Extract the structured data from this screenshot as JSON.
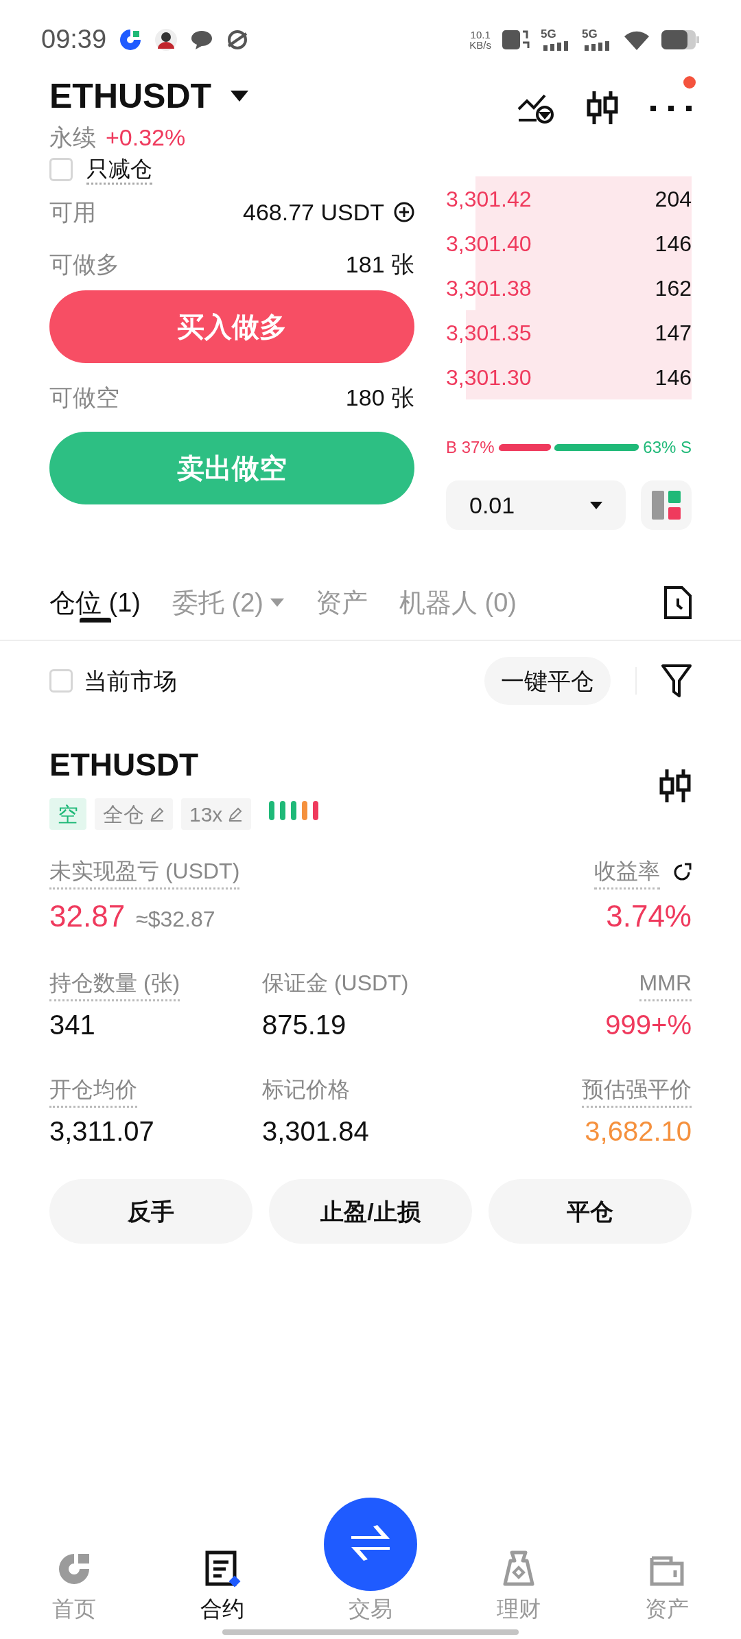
{
  "status_bar": {
    "time": "09:39",
    "speed": "10.1",
    "speed_unit": "KB/s",
    "sim_1": "5G",
    "sim_2": "5G"
  },
  "header": {
    "symbol": "ETHUSDT",
    "type": "永续",
    "change": "+0.32%",
    "notification": true
  },
  "order_form": {
    "reduce_only": {
      "label": "只减仓",
      "checked": false
    },
    "available": {
      "label": "可用",
      "value": "468.77 USDT"
    },
    "long": {
      "label": "可做多",
      "value": "181 张",
      "button": "买入做多"
    },
    "short": {
      "label": "可做空",
      "value": "180 张",
      "button": "卖出做空"
    }
  },
  "order_book": {
    "asks": [
      {
        "price": "3,301.42",
        "size": "204"
      },
      {
        "price": "3,301.40",
        "size": "146"
      },
      {
        "price": "3,301.38",
        "size": "162"
      },
      {
        "price": "3,301.35",
        "size": "147"
      },
      {
        "price": "3,301.30",
        "size": "146"
      }
    ],
    "buy_label": "B 37%",
    "sell_label": "63% S",
    "precision": "0.01"
  },
  "tabs": [
    {
      "label": "仓位 (1)",
      "selected": true,
      "dropdown": false
    },
    {
      "label": "委托 (2)",
      "selected": false,
      "dropdown": true
    },
    {
      "label": "资产",
      "selected": false,
      "dropdown": false
    },
    {
      "label": "机器人 (0)",
      "selected": false,
      "dropdown": false
    }
  ],
  "filter": {
    "label": "当前市场",
    "checked": false,
    "close_all": "一键平仓"
  },
  "position": {
    "symbol": "ETHUSDT",
    "side": "空",
    "margin_mode": "全仓",
    "leverage": "13x",
    "risk_bars": [
      {
        "color": "#1fb978"
      },
      {
        "color": "#1fb978"
      },
      {
        "color": "#1fb978"
      },
      {
        "color": "#f5913e"
      },
      {
        "color": "#ef3a5d"
      }
    ],
    "pnl": {
      "label": "未实现盈亏 (USDT)",
      "value": "32.87",
      "usd": "≈$32.87"
    },
    "roe": {
      "label": "收益率",
      "value": "3.74%"
    },
    "stats": [
      {
        "label": "持仓数量 (张)",
        "value": "341",
        "color": "#111111",
        "dotted": true
      },
      {
        "label": "保证金 (USDT)",
        "value": "875.19",
        "color": "#111111",
        "dotted": false
      },
      {
        "label": "MMR",
        "value": "999+%",
        "color": "#ef3a5d",
        "dotted": true
      },
      {
        "label": "开仓均价",
        "value": "3,311.07",
        "color": "#111111",
        "dotted": true
      },
      {
        "label": "标记价格",
        "value": "3,301.84",
        "color": "#111111",
        "dotted": false
      },
      {
        "label": "预估强平价",
        "value": "3,682.10",
        "color": "#f5913e",
        "dotted": true
      }
    ],
    "actions": [
      "反手",
      "止盈/止损",
      "平仓"
    ]
  },
  "bottom_nav": [
    {
      "label": "首页",
      "selected": false
    },
    {
      "label": "合约",
      "selected": true
    },
    {
      "label": "交易",
      "selected": false
    },
    {
      "label": "理财",
      "selected": false
    },
    {
      "label": "资产",
      "selected": false
    }
  ]
}
